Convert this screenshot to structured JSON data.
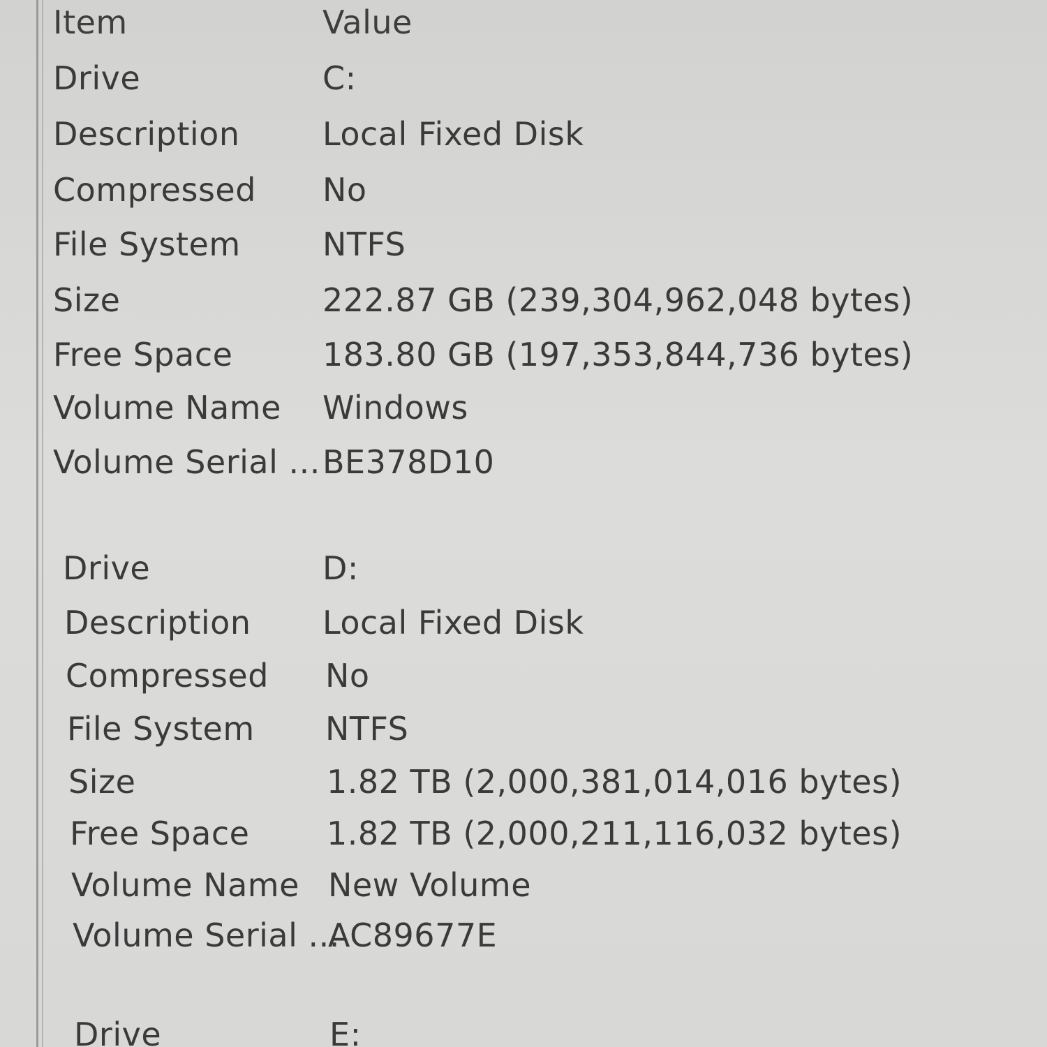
{
  "columns": {
    "item": "Item",
    "value": "Value"
  },
  "groups": [
    {
      "rows": [
        {
          "item": "Drive",
          "value": "C:"
        },
        {
          "item": "Description",
          "value": "Local Fixed Disk"
        },
        {
          "item": "Compressed",
          "value": "No"
        },
        {
          "item": "File System",
          "value": "NTFS"
        },
        {
          "item": "Size",
          "value": "222.87 GB (239,304,962,048 bytes)"
        },
        {
          "item": "Free Space",
          "value": "183.80 GB (197,353,844,736 bytes)"
        },
        {
          "item": "Volume Name",
          "value": "Windows"
        },
        {
          "item": "Volume Serial ...",
          "value": "BE378D10"
        }
      ]
    },
    {
      "rows": [
        {
          "item": "Drive",
          "value": "D:"
        },
        {
          "item": "Description",
          "value": "Local Fixed Disk"
        },
        {
          "item": "Compressed",
          "value": "No"
        },
        {
          "item": "File System",
          "value": "NTFS"
        },
        {
          "item": "Size",
          "value": "1.82 TB (2,000,381,014,016 bytes)"
        },
        {
          "item": "Free Space",
          "value": "1.82 TB (2,000,211,116,032 bytes)"
        },
        {
          "item": "Volume Name",
          "value": "New Volume"
        },
        {
          "item": "Volume Serial ...",
          "value": "AC89677E"
        }
      ]
    },
    {
      "rows": [
        {
          "item": "Drive",
          "value": "E:"
        }
      ]
    }
  ]
}
